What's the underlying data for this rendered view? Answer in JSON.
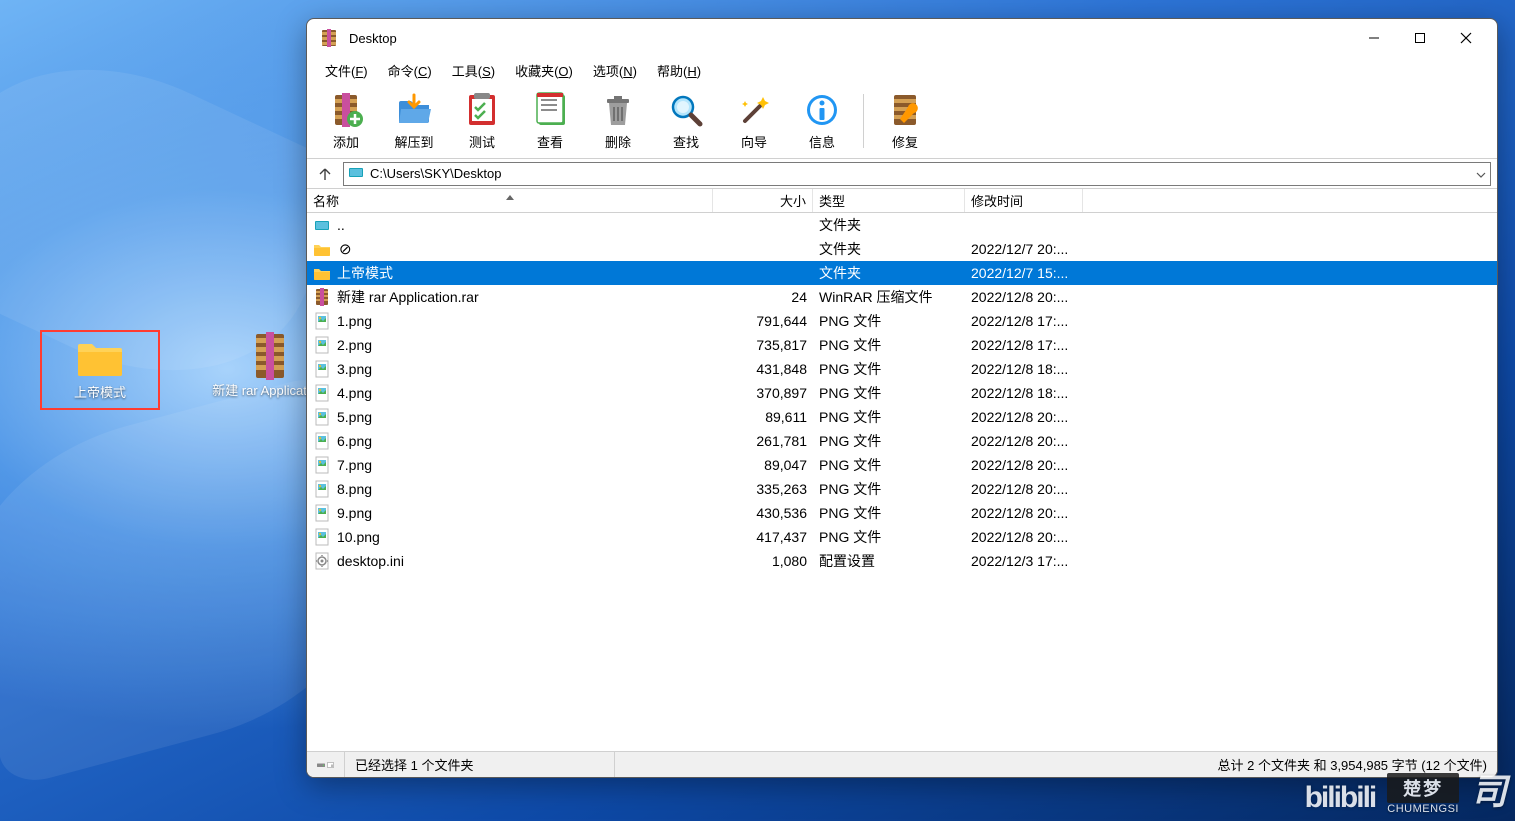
{
  "desktop": {
    "icons": [
      {
        "label": "上帝模式",
        "type": "folder",
        "highlighted": true
      },
      {
        "label": "新建 rar Applicatio...",
        "type": "rar",
        "highlighted": false
      }
    ]
  },
  "window": {
    "title": "Desktop",
    "menubar": [
      {
        "label": "文件",
        "key": "F"
      },
      {
        "label": "命令",
        "key": "C"
      },
      {
        "label": "工具",
        "key": "S"
      },
      {
        "label": "收藏夹",
        "key": "O"
      },
      {
        "label": "选项",
        "key": "N"
      },
      {
        "label": "帮助",
        "key": "H"
      }
    ],
    "toolbar": [
      {
        "id": "add",
        "label": "添加"
      },
      {
        "id": "extract",
        "label": "解压到"
      },
      {
        "id": "test",
        "label": "测试"
      },
      {
        "id": "view",
        "label": "查看"
      },
      {
        "id": "delete",
        "label": "删除"
      },
      {
        "id": "find",
        "label": "查找"
      },
      {
        "id": "wizard",
        "label": "向导"
      },
      {
        "id": "info",
        "label": "信息"
      },
      {
        "id": "repair",
        "label": "修复"
      }
    ],
    "path": "C:\\Users\\SKY\\Desktop",
    "columns": {
      "name": "名称",
      "size": "大小",
      "type": "类型",
      "date": "修改时间"
    },
    "rows": [
      {
        "icon": "drive",
        "name": "..",
        "size": "",
        "type": "文件夹",
        "date": "",
        "sel": false
      },
      {
        "icon": "folder-x",
        "name": "",
        "size": "",
        "type": "文件夹",
        "date": "2022/12/7 20:...",
        "sel": false
      },
      {
        "icon": "folder",
        "name": "上帝模式",
        "size": "",
        "type": "文件夹",
        "date": "2022/12/7 15:...",
        "sel": true
      },
      {
        "icon": "rar",
        "name": "新建 rar Application.rar",
        "size": "24",
        "type": "WinRAR 压缩文件",
        "date": "2022/12/8 20:...",
        "sel": false
      },
      {
        "icon": "png",
        "name": "1.png",
        "size": "791,644",
        "type": "PNG 文件",
        "date": "2022/12/8 17:...",
        "sel": false
      },
      {
        "icon": "png",
        "name": "2.png",
        "size": "735,817",
        "type": "PNG 文件",
        "date": "2022/12/8 17:...",
        "sel": false
      },
      {
        "icon": "png",
        "name": "3.png",
        "size": "431,848",
        "type": "PNG 文件",
        "date": "2022/12/8 18:...",
        "sel": false
      },
      {
        "icon": "png",
        "name": "4.png",
        "size": "370,897",
        "type": "PNG 文件",
        "date": "2022/12/8 18:...",
        "sel": false
      },
      {
        "icon": "png",
        "name": "5.png",
        "size": "89,611",
        "type": "PNG 文件",
        "date": "2022/12/8 20:...",
        "sel": false
      },
      {
        "icon": "png",
        "name": "6.png",
        "size": "261,781",
        "type": "PNG 文件",
        "date": "2022/12/8 20:...",
        "sel": false
      },
      {
        "icon": "png",
        "name": "7.png",
        "size": "89,047",
        "type": "PNG 文件",
        "date": "2022/12/8 20:...",
        "sel": false
      },
      {
        "icon": "png",
        "name": "8.png",
        "size": "335,263",
        "type": "PNG 文件",
        "date": "2022/12/8 20:...",
        "sel": false
      },
      {
        "icon": "png",
        "name": "9.png",
        "size": "430,536",
        "type": "PNG 文件",
        "date": "2022/12/8 20:...",
        "sel": false
      },
      {
        "icon": "png",
        "name": "10.png",
        "size": "417,437",
        "type": "PNG 文件",
        "date": "2022/12/8 20:...",
        "sel": false
      },
      {
        "icon": "ini",
        "name": "desktop.ini",
        "size": "1,080",
        "type": "配置设置",
        "date": "2022/12/3 17:...",
        "sel": false
      }
    ],
    "status": {
      "left": "已经选择 1 个文件夹",
      "right": "总计 2 个文件夹 和 3,954,985 字节 (12 个文件)"
    }
  },
  "watermark": {
    "bili": "bilibili",
    "cm_cn": "楚梦",
    "cm_py": "CHUMENGSI",
    "s": "司"
  }
}
